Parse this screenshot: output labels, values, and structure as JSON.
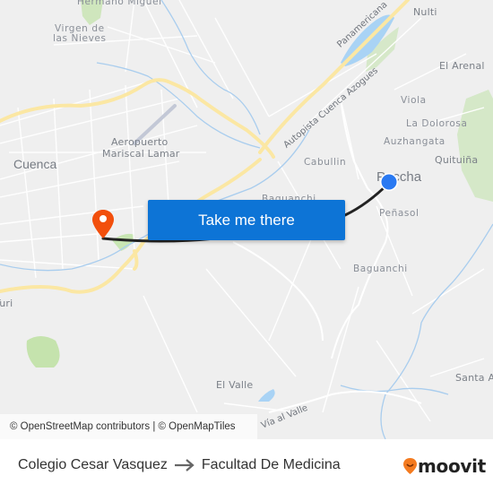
{
  "map": {
    "places": [
      {
        "id": "hermano-miguel",
        "label": "Hermano Miguel"
      },
      {
        "id": "virgen-de-las-nieves-1",
        "label": "Virgen de"
      },
      {
        "id": "virgen-de-las-nieves-2",
        "label": "las Nieves"
      },
      {
        "id": "nulti",
        "label": "Nulti"
      },
      {
        "id": "el-arenal",
        "label": "El Arenal"
      },
      {
        "id": "viola",
        "label": "Viola"
      },
      {
        "id": "la-dolorosa",
        "label": "La Dolorosa"
      },
      {
        "id": "auzhangata",
        "label": "Auzhangata"
      },
      {
        "id": "quituina",
        "label": "Quituiña"
      },
      {
        "id": "cabullin",
        "label": "Cabullin"
      },
      {
        "id": "paccha",
        "label": "Paccha"
      },
      {
        "id": "penasol",
        "label": "Peñasol"
      },
      {
        "id": "baguanchi-upper",
        "label": "Baguanchi"
      },
      {
        "id": "baguanchi",
        "label": "Baguanchi"
      },
      {
        "id": "cuenca",
        "label": "Cuenca"
      },
      {
        "id": "aeropuerto-1",
        "label": "Aeropuerto"
      },
      {
        "id": "aeropuerto-2",
        "label": "Mariscal Lamar"
      },
      {
        "id": "turi",
        "label": "Turi"
      },
      {
        "id": "el-valle",
        "label": "El Valle"
      },
      {
        "id": "santa-ana",
        "label": "Santa Ana"
      }
    ],
    "roads": [
      {
        "id": "panamericana",
        "label": "Panamericana"
      },
      {
        "id": "autopista",
        "label": "Autopista Cuenca Azogues"
      },
      {
        "id": "via-al-valle",
        "label": "Vía al Valle"
      }
    ],
    "markers": {
      "origin": {
        "name": "Colegio Cesar Vasquez",
        "color": "#2979f2",
        "icon": "origin-dot-icon"
      },
      "destination": {
        "name": "Facultad De Medicina",
        "color": "#f24f0c",
        "icon": "destination-pin-icon"
      }
    },
    "cta_label": "Take me there",
    "cta_color": "#0d74d6",
    "attribution": "© OpenStreetMap contributors | © OpenMapTiles"
  },
  "footer": {
    "from": "Colegio Cesar Vasquez",
    "to": "Facultad De Medicina",
    "arrow_icon": "arrow-right-icon",
    "brand": {
      "name": "moovit",
      "color": "#f47b20"
    }
  }
}
